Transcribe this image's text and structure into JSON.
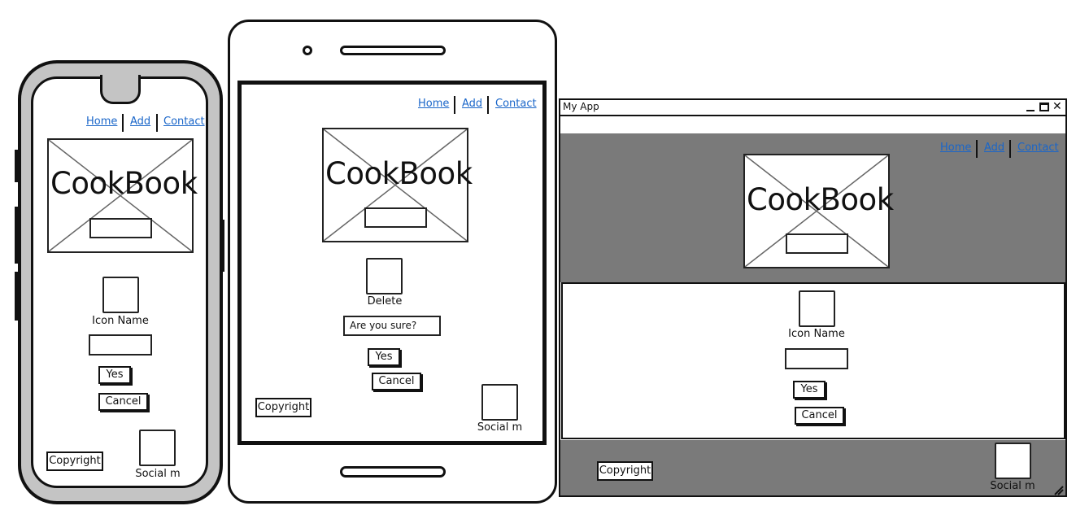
{
  "nav": {
    "home": "Home",
    "add": "Add",
    "contact": "Contact"
  },
  "brand": "CookBook",
  "phone": {
    "icon_label": "Icon Name",
    "yes": "Yes",
    "cancel": "Cancel",
    "copyright": "Copyright",
    "social": "Social m"
  },
  "tablet": {
    "icon_label": "Delete",
    "confirm_text": "Are you sure?",
    "yes": "Yes",
    "cancel": "Cancel",
    "copyright": "Copyright",
    "social": "Social m"
  },
  "desktop": {
    "window_title": "My App",
    "icon_label": "Icon Name",
    "yes": "Yes",
    "cancel": "Cancel",
    "copyright": "Copyright",
    "social": "Social m"
  },
  "colors": {
    "link": "#1a66c9",
    "device_frame": "#c4c4c4",
    "dark_band": "#7a7a7a"
  },
  "icons": [
    "minimize-icon",
    "maximize-icon",
    "close-icon",
    "resize-grip-icon",
    "image-placeholder-icon"
  ]
}
